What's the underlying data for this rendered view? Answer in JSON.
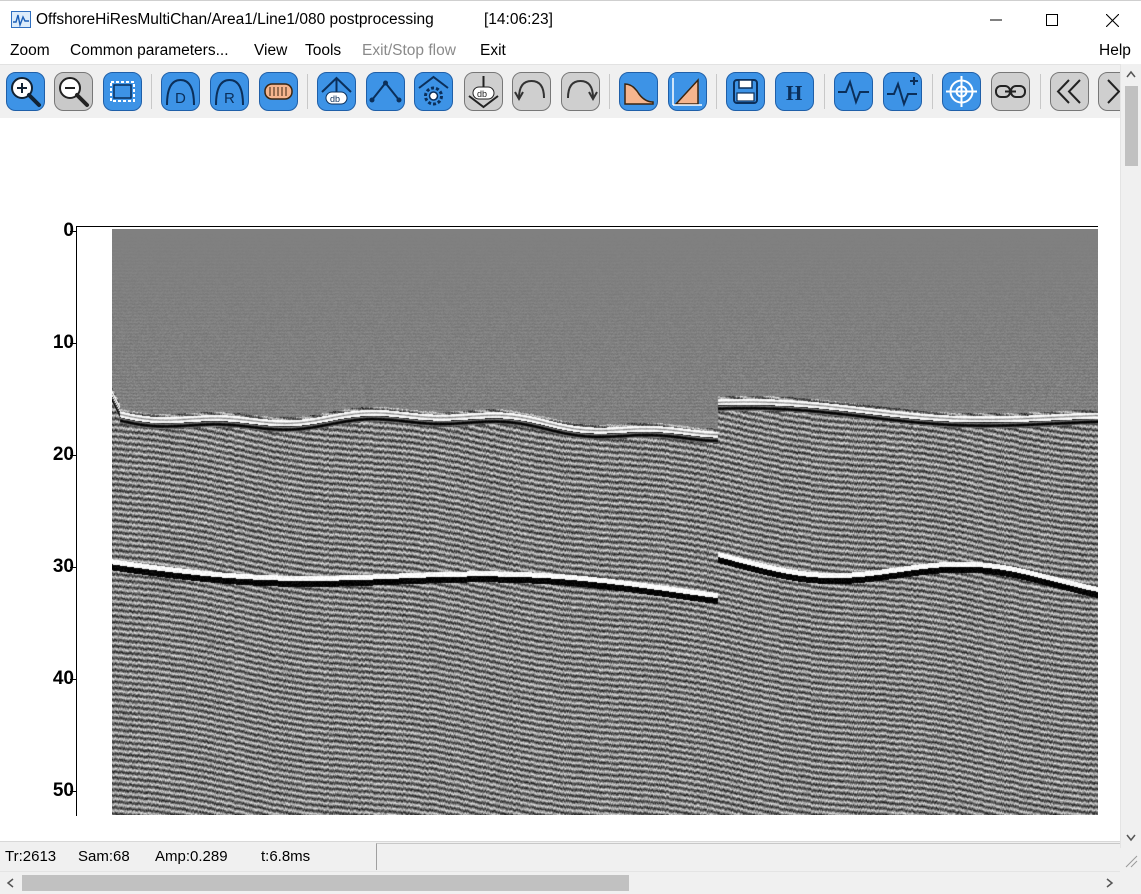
{
  "window": {
    "title": "OffshoreHiResMultiChan/Area1/Line1/080 postprocessing",
    "clock": "[14:06:23]"
  },
  "menu": {
    "zoom": "Zoom",
    "common_parameters": "Common parameters...",
    "view": "View",
    "tools": "Tools",
    "exit_stop_flow": "Exit/Stop flow",
    "exit": "Exit",
    "help": "Help"
  },
  "toolbar": {
    "icons": [
      "zoom-in-icon",
      "zoom-out-icon",
      "fit-screen-icon",
      "d-curve-icon",
      "r-curve-icon",
      "gain-bar-icon",
      "db-up-icon",
      "peak-line-icon",
      "gear-up-icon",
      "db-down-icon",
      "rotate-left-icon",
      "rotate-right-icon",
      "area-fill-icon",
      "slope-icon",
      "save-icon",
      "header-icon",
      "wiggle-icon",
      "wiggle-plus-icon",
      "crosshair-icon",
      "link-icon",
      "rewind-icon",
      "forward-icon"
    ],
    "accent": "#2f8de4"
  },
  "plot": {
    "y_ticks": [
      "0",
      "10",
      "20",
      "30",
      "40",
      "50"
    ]
  },
  "status": {
    "trace": "Tr:2613",
    "sample": "Sam:68",
    "amplitude": "Amp:0.289",
    "time": "t:6.8ms"
  }
}
